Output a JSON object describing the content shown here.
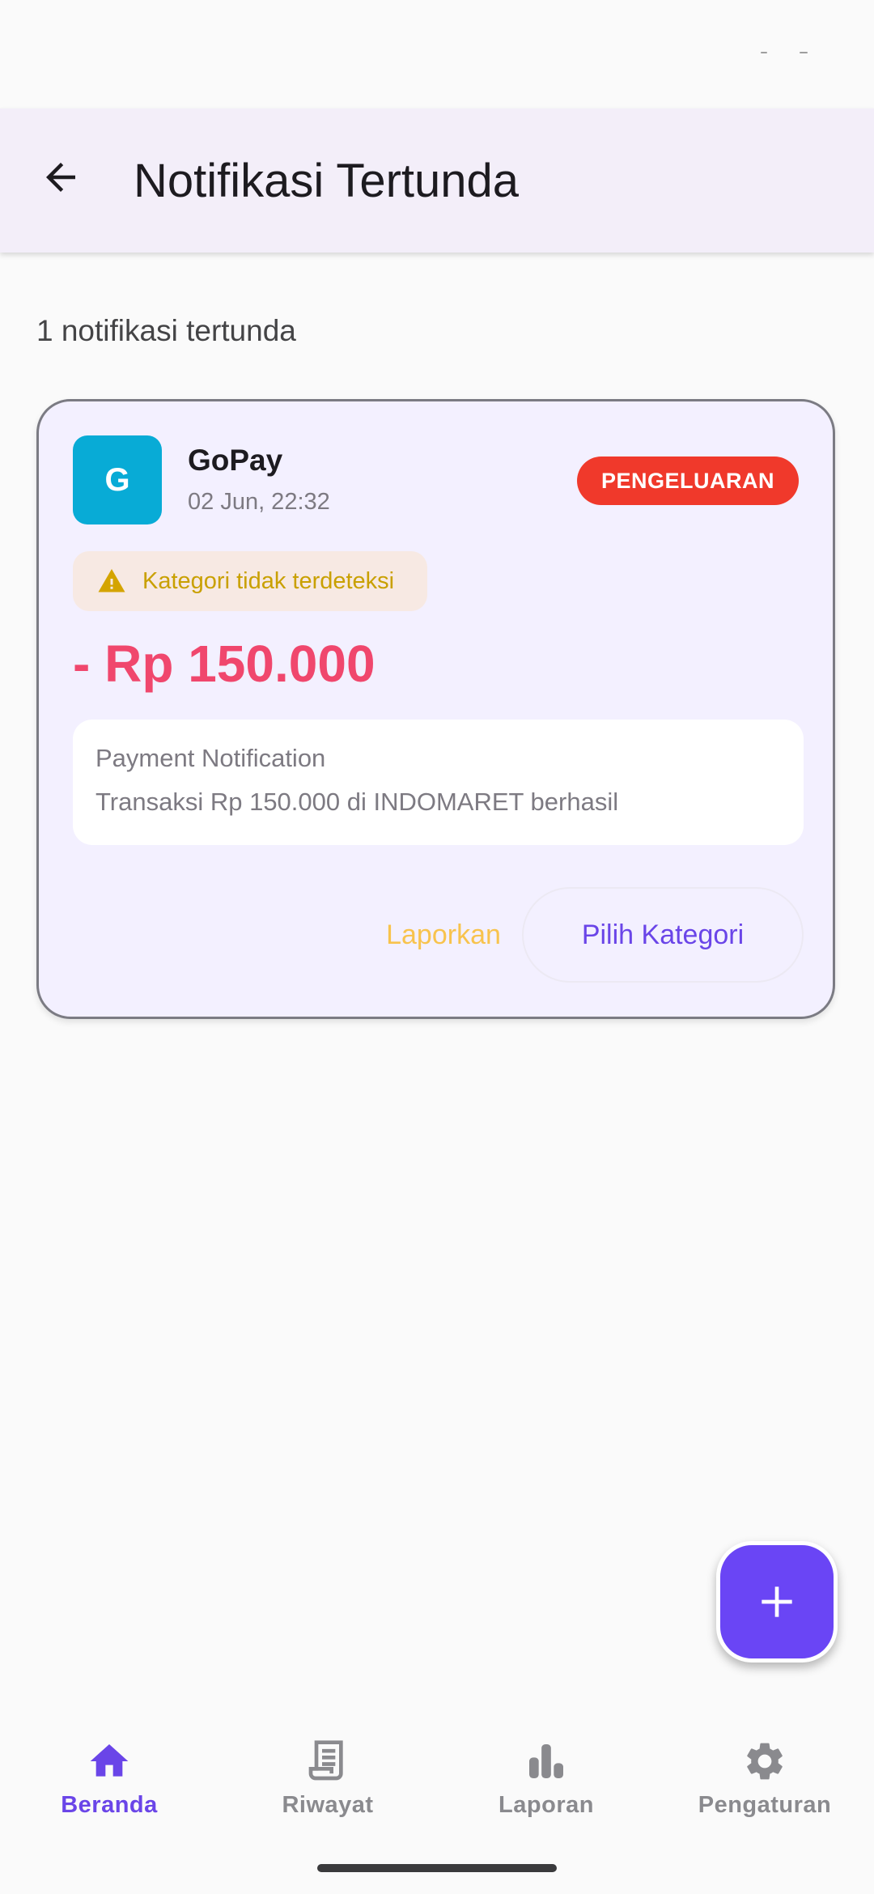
{
  "app_bar": {
    "title": "Notifikasi Tertunda",
    "back_icon": "arrow-left-icon"
  },
  "pending": {
    "count_text": "1 notifikasi tertunda"
  },
  "notification": {
    "avatar_letter": "G",
    "avatar_color": "#08abd6",
    "source": "GoPay",
    "timestamp": "02 Jun, 22:32",
    "type_badge": "PENGELUARAN",
    "type_badge_color": "#f0392b",
    "warning_icon": "warning-triangle-icon",
    "warning_text": "Kategori tidak terdeteksi",
    "amount": "- Rp 150.000",
    "amount_color": "#f0476d",
    "message_title": "Payment Notification",
    "message_body": "Transaksi Rp 150.000 di INDOMARET berhasil",
    "report_label": "Laporkan",
    "choose_category_label": "Pilih Kategori"
  },
  "fab": {
    "icon": "plus-icon",
    "color": "#6a45f5"
  },
  "bottom_nav": {
    "items": [
      {
        "label": "Beranda",
        "icon": "home-icon",
        "active": true
      },
      {
        "label": "Riwayat",
        "icon": "receipt-icon",
        "active": false
      },
      {
        "label": "Laporan",
        "icon": "bar-chart-icon",
        "active": false
      },
      {
        "label": "Pengaturan",
        "icon": "gear-icon",
        "active": false
      }
    ],
    "active_color": "#6a45e8",
    "inactive_color": "#8a8a8e"
  }
}
